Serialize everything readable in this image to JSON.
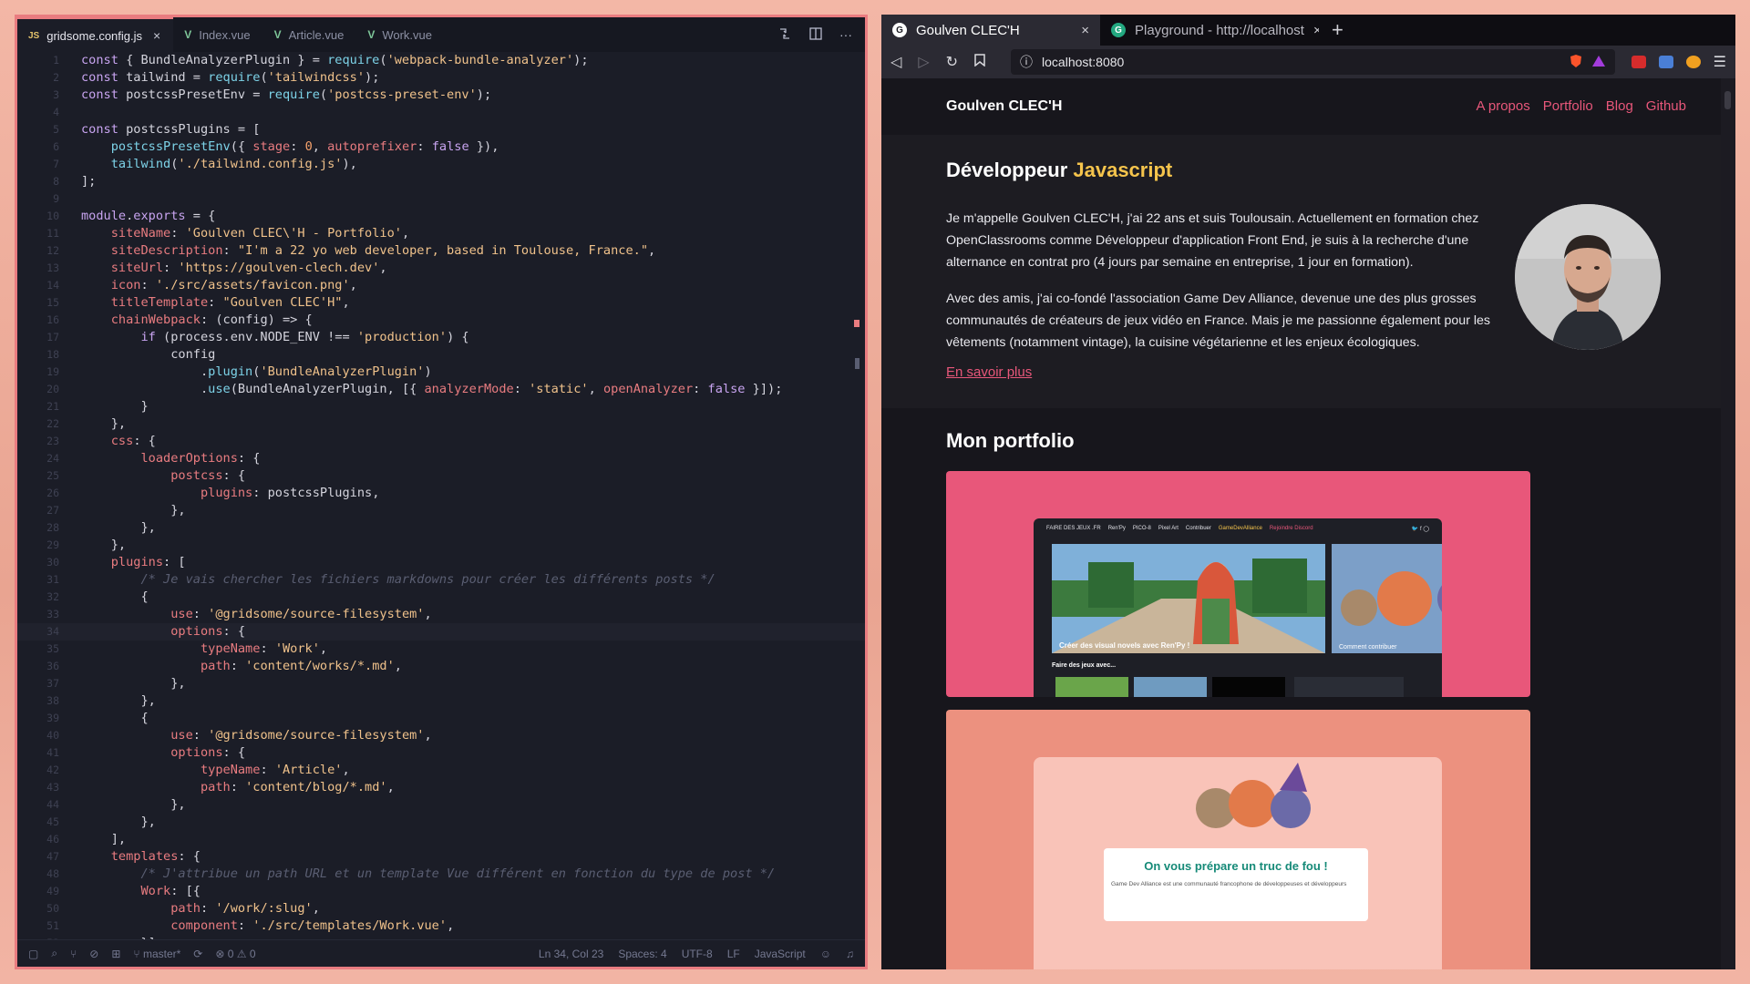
{
  "editor": {
    "tabs": [
      {
        "label": "gridsome.config.js",
        "type": "js",
        "active": true
      },
      {
        "label": "Index.vue",
        "type": "vue",
        "active": false
      },
      {
        "label": "Article.vue",
        "type": "vue",
        "active": false
      },
      {
        "label": "Work.vue",
        "type": "vue",
        "active": false
      }
    ],
    "file_type_js": "JS",
    "file_type_vue": "V",
    "close_glyph": "×",
    "more_glyph": "···",
    "current_line": 34,
    "lines": [
      "const { BundleAnalyzerPlugin } = require('webpack-bundle-analyzer');",
      "const tailwind = require('tailwindcss');",
      "const postcssPresetEnv = require('postcss-preset-env');",
      "",
      "const postcssPlugins = [",
      "    postcssPresetEnv({ stage: 0, autoprefixer: false }),",
      "    tailwind('./tailwind.config.js'),",
      "];",
      "",
      "module.exports = {",
      "    siteName: 'Goulven CLEC\\'H - Portfolio',",
      "    siteDescription: \"I'm a 22 yo web developer, based in Toulouse, France.\",",
      "    siteUrl: 'https://goulven-clech.dev',",
      "    icon: './src/assets/favicon.png',",
      "    titleTemplate: \"Goulven CLEC'H\",",
      "    chainWebpack: (config) => {",
      "        if (process.env.NODE_ENV !== 'production') {",
      "            config",
      "                .plugin('BundleAnalyzerPlugin')",
      "                .use(BundleAnalyzerPlugin, [{ analyzerMode: 'static', openAnalyzer: false }]);",
      "        }",
      "    },",
      "    css: {",
      "        loaderOptions: {",
      "            postcss: {",
      "                plugins: postcssPlugins,",
      "            },",
      "        },",
      "    },",
      "    plugins: [",
      "        /* Je vais chercher les fichiers markdowns pour créer les différents posts */",
      "        {",
      "            use: '@gridsome/source-filesystem',",
      "            options: {",
      "                typeName: 'Work',",
      "                path: 'content/works/*.md',",
      "            },",
      "        },",
      "        {",
      "            use: '@gridsome/source-filesystem',",
      "            options: {",
      "                typeName: 'Article',",
      "                path: 'content/blog/*.md',",
      "            },",
      "        },",
      "    ],",
      "    templates: {",
      "        /* J'attribue un path URL et un template Vue différent en fonction du type de post */",
      "        Work: [{",
      "            path: '/work/:slug',",
      "            component: './src/templates/Work.vue',",
      "        }],"
    ],
    "status": {
      "branch": "master*",
      "problems": "⊗ 0 ⚠ 0",
      "position": "Ln 34, Col 23",
      "spaces": "Spaces: 4",
      "encoding": "UTF-8",
      "eol": "LF",
      "language": "JavaScript"
    }
  },
  "browser": {
    "tabs": [
      {
        "favicon": "G",
        "title": "Goulven CLEC'H",
        "active": true
      },
      {
        "favicon": "G",
        "title": "Playground - http://localhost",
        "active": false
      }
    ],
    "new_tab": "+",
    "close_glyph": "×",
    "url": "localhost:8080",
    "site": {
      "title": "Goulven CLEC'H",
      "nav": [
        "A propos",
        "Portfolio",
        "Blog",
        "Github"
      ],
      "hero_title_prefix": "Développeur ",
      "hero_title_accent": "Javascript",
      "paragraph1": "Je m'appelle Goulven CLEC'H, j'ai 22 ans et suis Toulousain. Actuellement en formation chez OpenClassrooms comme Développeur d'application Front End, je suis à la recherche d'une alternance en contrat pro (4 jours par semaine en entreprise, 1 jour en formation).",
      "paragraph2": "Avec des amis, j'ai co-fondé l'association Game Dev Alliance, devenue une des plus grosses communautés de créateurs de jeux vidéo en France. Mais je me passionne également pour les vêtements (notamment vintage), la cuisine végétarienne et les enjeux écologiques.",
      "more_link": "En savoir plus",
      "portfolio_title": "Mon portfolio",
      "card1": {
        "nav": [
          "FAIRE DES JEUX .FR",
          "Ren'Py",
          "PICO-8",
          "Pixel Art",
          "Contribuer",
          "GameDevAlliance",
          "Rejoindre Discord"
        ],
        "social": "🐦 f ◯",
        "feature_label": "Créer des visual novels avec Ren'Py !",
        "side_label": "Comment contribuer",
        "section_label": "Faire des jeux avec..."
      },
      "card2": {
        "heading": "On vous prépare un truc de fou !",
        "text": "Game Dev Alliance est une communauté francophone de développeuses et développeurs"
      }
    },
    "colors": {
      "accent": "#e8577a",
      "yellow": "#f5c44c",
      "card1": "#e8577a",
      "card2": "#ec917f"
    }
  }
}
